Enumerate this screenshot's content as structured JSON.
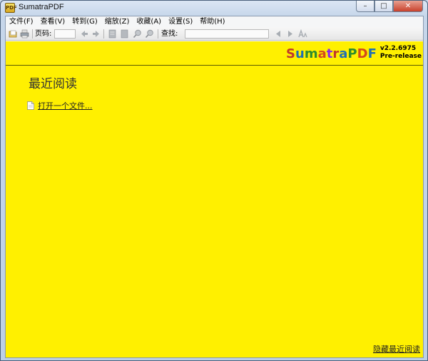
{
  "window": {
    "title": "SumatraPDF",
    "app_icon_text": "PDF"
  },
  "caption_buttons": {
    "minimize": "–",
    "maximize": "□",
    "close": "✕"
  },
  "menu": [
    {
      "label": "文件(F)"
    },
    {
      "label": "查看(V)"
    },
    {
      "label": "转到(G)"
    },
    {
      "label": "缩放(Z)"
    },
    {
      "label": "收藏(A)"
    },
    {
      "label": "设置(S)"
    },
    {
      "label": "帮助(H)"
    }
  ],
  "toolbar": {
    "page_label": "页码:",
    "page_value": "",
    "find_label": "查找:",
    "find_value": ""
  },
  "logo": {
    "letters": [
      {
        "ch": "S",
        "color": "#c0392b"
      },
      {
        "ch": "u",
        "color": "#1f6fb2"
      },
      {
        "ch": "m",
        "color": "#2e8b2e"
      },
      {
        "ch": "a",
        "color": "#d4491c"
      },
      {
        "ch": "t",
        "color": "#8a2be2"
      },
      {
        "ch": "r",
        "color": "#c0392b"
      },
      {
        "ch": "a",
        "color": "#1f6fb2"
      },
      {
        "ch": "P",
        "color": "#2e8b2e"
      },
      {
        "ch": "D",
        "color": "#d4491c"
      },
      {
        "ch": "F",
        "color": "#1f6fb2"
      }
    ],
    "version": "v2.2.6975",
    "channel": "Pre-release"
  },
  "main": {
    "recent_title": "最近阅读",
    "open_file_label": "打开一个文件...",
    "hide_recent_label": "隐藏最近阅读"
  },
  "colors": {
    "background": "#fff000"
  }
}
